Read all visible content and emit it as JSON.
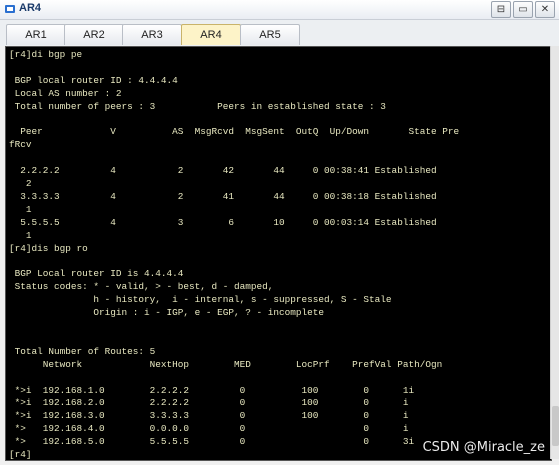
{
  "window": {
    "title": "AR4",
    "minimize_glyph": "⊟",
    "restore_glyph": "▭",
    "close_glyph": "✕"
  },
  "tabs": [
    {
      "label": "AR1",
      "active": false
    },
    {
      "label": "AR2",
      "active": false
    },
    {
      "label": "AR3",
      "active": false
    },
    {
      "label": "AR4",
      "active": true
    },
    {
      "label": "AR5",
      "active": false
    }
  ],
  "terminal": {
    "lines": [
      "[r4]di bgp pe",
      "",
      " BGP local router ID : 4.4.4.4",
      " Local AS number : 2",
      " Total number of peers : 3           Peers in established state : 3",
      "",
      "  Peer            V          AS  MsgRcvd  MsgSent  OutQ  Up/Down       State Pre",
      "fRcv",
      "",
      "  2.2.2.2         4           2       42       44     0 00:38:41 Established",
      "   2",
      "  3.3.3.3         4           2       41       44     0 00:38:18 Established",
      "   1",
      "  5.5.5.5         4           3        6       10     0 00:03:14 Established",
      "   1",
      "[r4]dis bgp ro",
      "",
      " BGP Local router ID is 4.4.4.4",
      " Status codes: * - valid, > - best, d - damped,",
      "               h - history,  i - internal, s - suppressed, S - Stale",
      "               Origin : i - IGP, e - EGP, ? - incomplete",
      "",
      "",
      " Total Number of Routes: 5",
      "      Network            NextHop        MED        LocPrf    PrefVal Path/Ogn",
      "",
      " *>i  192.168.1.0        2.2.2.2         0          100        0      1i",
      " *>i  192.168.2.0        2.2.2.2         0          100        0      i",
      " *>i  192.168.3.0        3.3.3.3         0          100        0      i",
      " *>   192.168.4.0        0.0.0.0         0                     0      i",
      " *>   192.168.5.0        5.5.5.5         0                     0      3i",
      "[r4]"
    ]
  },
  "watermark": "CSDN @Miracle_ze"
}
